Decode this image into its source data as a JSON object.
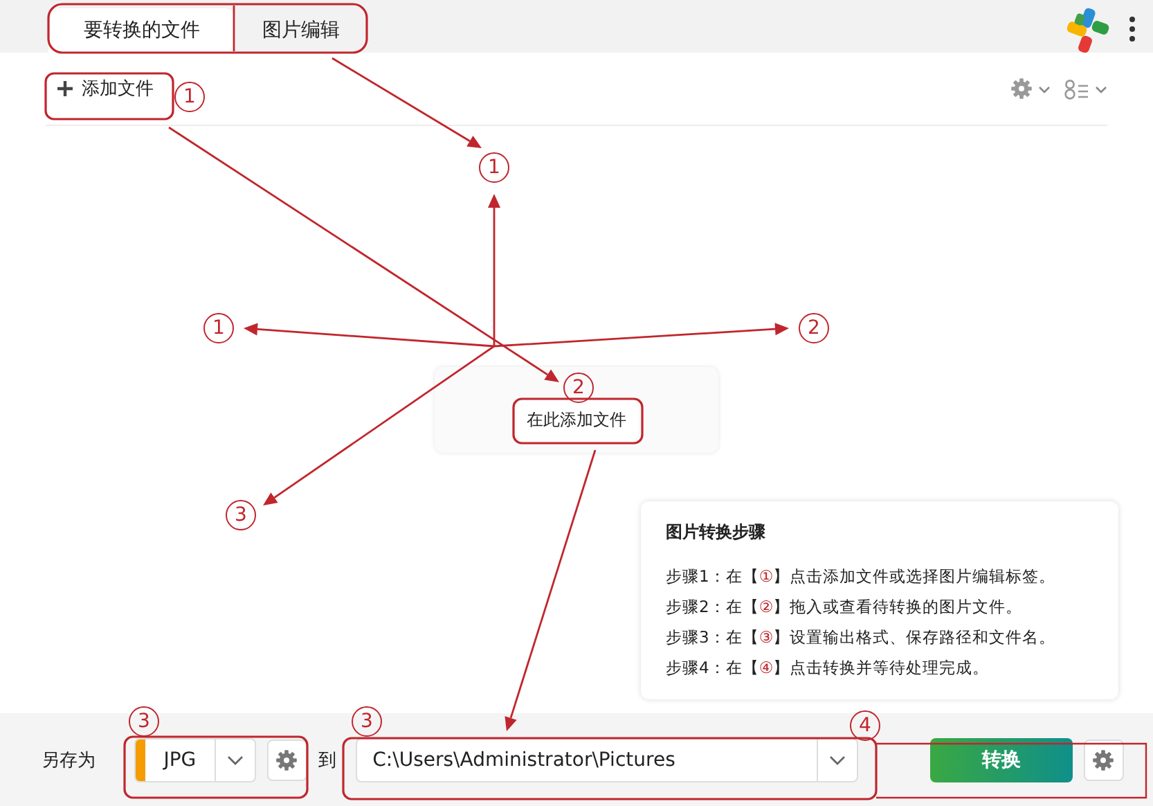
{
  "tabs": [
    {
      "label": "要转换的文件",
      "selected": true
    },
    {
      "label": "图片编辑",
      "selected": false
    }
  ],
  "toolbar": {
    "add_button": "添加文件"
  },
  "drop_zone": {
    "button": "在此添加文件"
  },
  "steps": {
    "title": "图片转换步骤",
    "items": [
      {
        "prefix": "步骤1：在【",
        "marker": "①",
        "text": "】点击添加文件或选择图片编辑标签。"
      },
      {
        "prefix": "步骤2：在【",
        "marker": "②",
        "text": "】拖入或查看待转换的图片文件。"
      },
      {
        "prefix": "步骤3：在【",
        "marker": "③",
        "text": "】设置输出格式、保存路径和文件名。"
      },
      {
        "prefix": "步骤4：在【",
        "marker": "④",
        "text": "】点击转换并等待处理完成。"
      }
    ]
  },
  "bottom_bar": {
    "save_as_label": "另存为",
    "format": "JPG",
    "to_label": "到",
    "path": "C:\\Users\\Administrator\\Pictures",
    "convert_button": "转换"
  },
  "annotations": {
    "markers": [
      "1",
      "1",
      "1",
      "2",
      "2",
      "3",
      "3",
      "3",
      "4"
    ]
  }
}
